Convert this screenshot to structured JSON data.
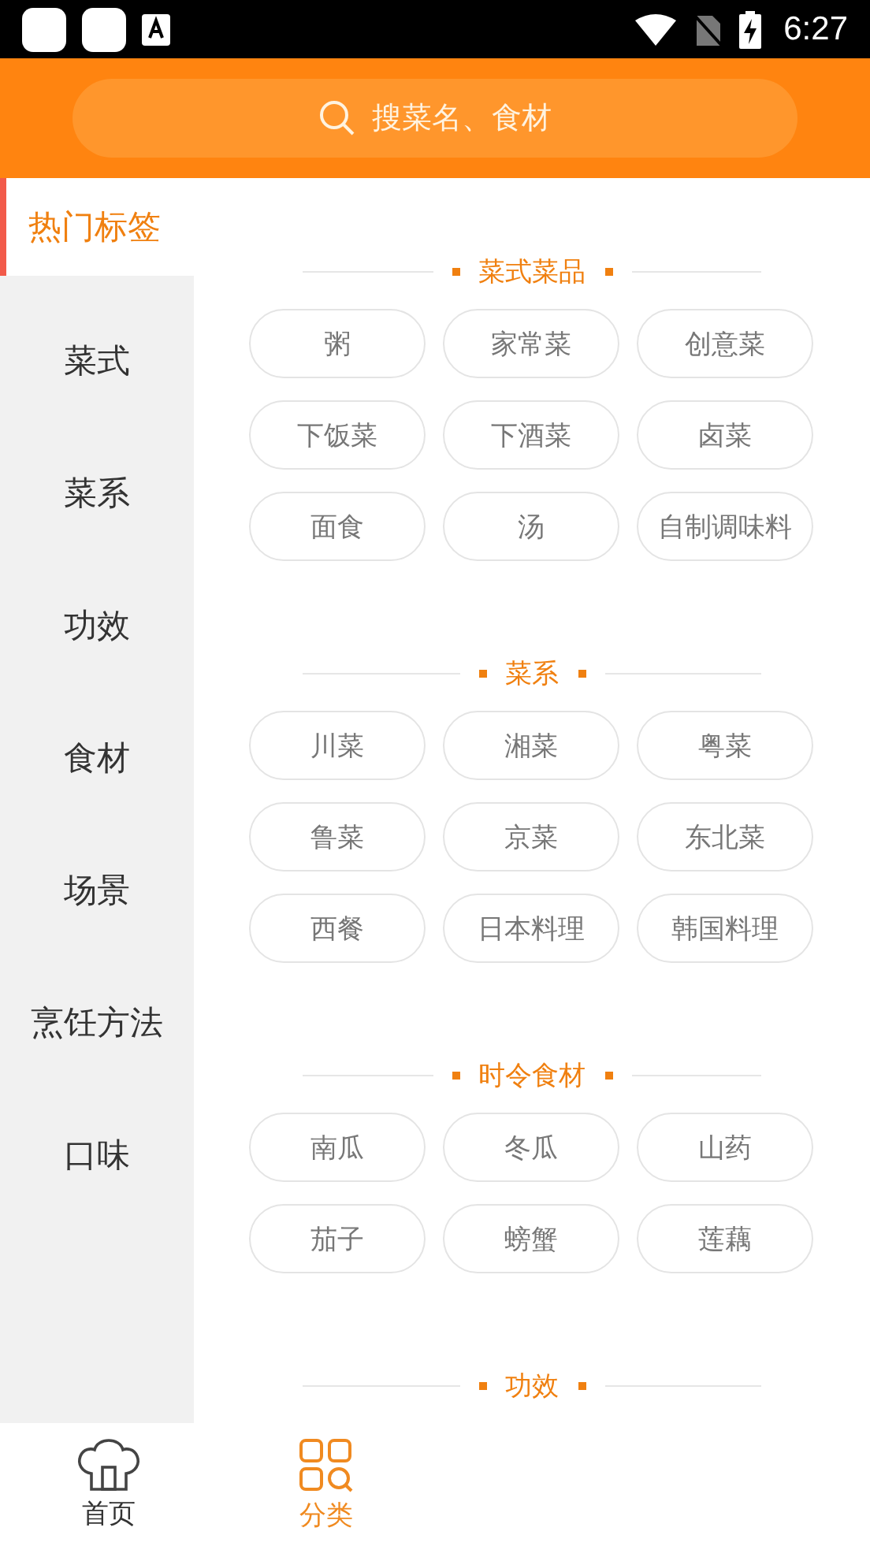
{
  "status_bar": {
    "time": "6:27"
  },
  "search": {
    "placeholder": "搜菜名、食材"
  },
  "sidebar": {
    "items": [
      {
        "label": "热门标签",
        "selected": true
      },
      {
        "label": "菜式",
        "selected": false
      },
      {
        "label": "菜系",
        "selected": false
      },
      {
        "label": "功效",
        "selected": false
      },
      {
        "label": "食材",
        "selected": false
      },
      {
        "label": "场景",
        "selected": false
      },
      {
        "label": "烹饪方法",
        "selected": false
      },
      {
        "label": "口味",
        "selected": false
      }
    ]
  },
  "sections": [
    {
      "title": "菜式菜品",
      "tags": [
        "粥",
        "家常菜",
        "创意菜",
        "下饭菜",
        "下酒菜",
        "卤菜",
        "面食",
        "汤",
        "自制调味料"
      ]
    },
    {
      "title": "菜系",
      "tags": [
        "川菜",
        "湘菜",
        "粤菜",
        "鲁菜",
        "京菜",
        "东北菜",
        "西餐",
        "日本料理",
        "韩国料理"
      ]
    },
    {
      "title": "时令食材",
      "tags": [
        "南瓜",
        "冬瓜",
        "山药",
        "茄子",
        "螃蟹",
        "莲藕"
      ]
    },
    {
      "title": "功效"
    }
  ],
  "bottom_nav": [
    {
      "label": "首页",
      "kind": "home",
      "selected": false
    },
    {
      "label": "分类",
      "kind": "category",
      "selected": true
    }
  ]
}
